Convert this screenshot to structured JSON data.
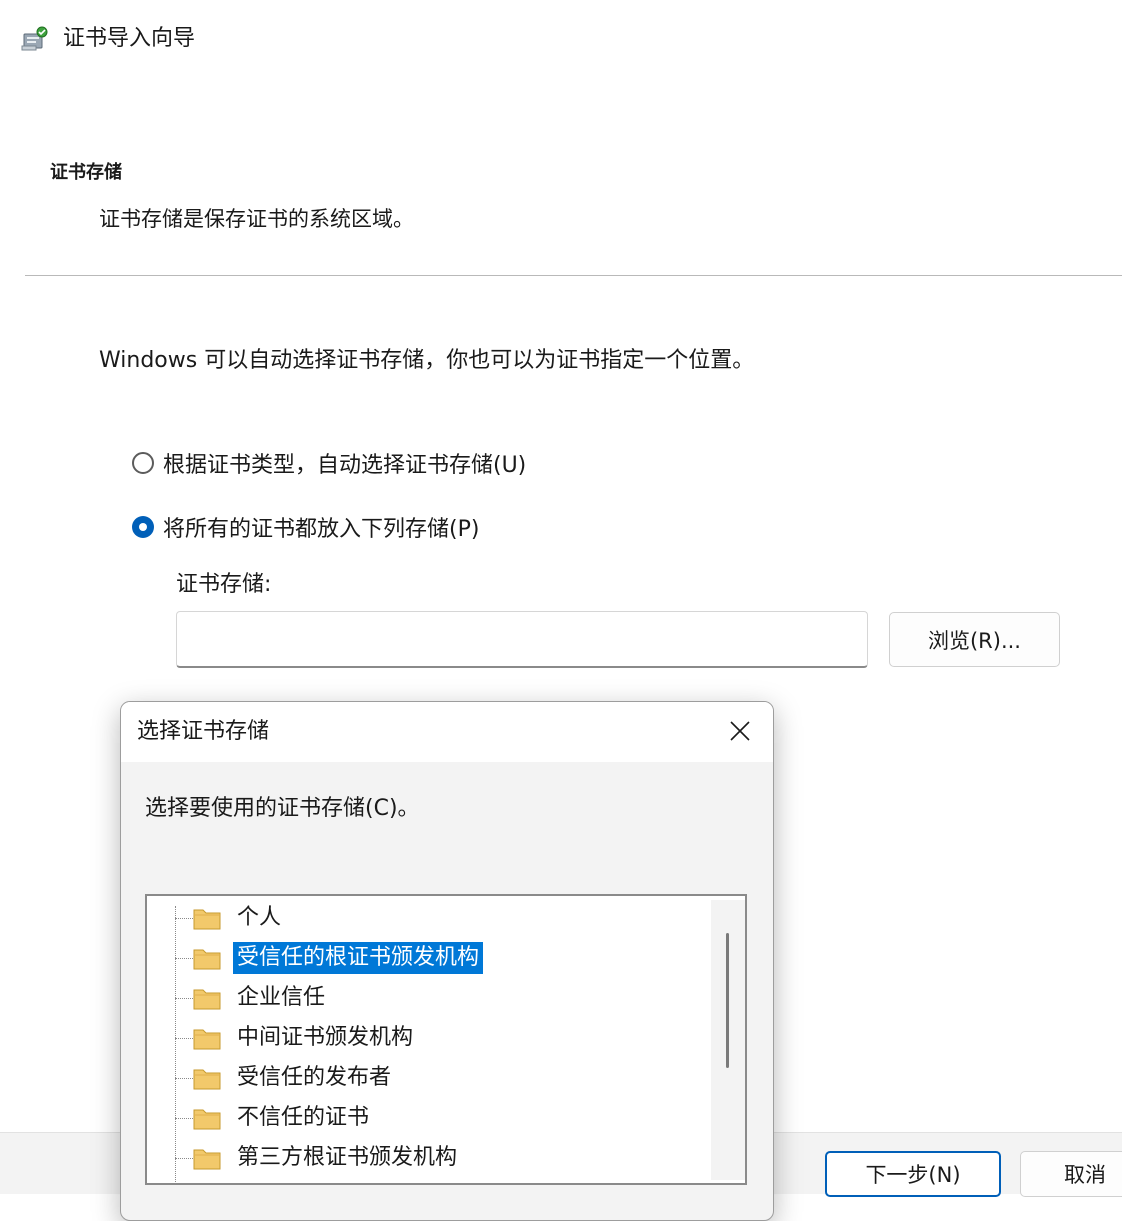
{
  "window": {
    "title": "证书导入向导"
  },
  "page": {
    "section_title": "证书存储",
    "section_desc": "证书存储是保存证书的系统区域。",
    "intro": "Windows 可以自动选择证书存储，你也可以为证书指定一个位置。"
  },
  "options": {
    "auto": {
      "label": "根据证书类型，自动选择证书存储(U)",
      "checked": false
    },
    "manual": {
      "label": "将所有的证书都放入下列存储(P)",
      "checked": true
    }
  },
  "store": {
    "label": "证书存储:",
    "value": ""
  },
  "buttons": {
    "browse": "浏览(R)...",
    "next": "下一步(N)",
    "cancel": "取消"
  },
  "dialog": {
    "title": "选择证书存储",
    "prompt": "选择要使用的证书存储(C)。",
    "stores": [
      {
        "label": "个人",
        "selected": false
      },
      {
        "label": "受信任的根证书颁发机构",
        "selected": true
      },
      {
        "label": "企业信任",
        "selected": false
      },
      {
        "label": "中间证书颁发机构",
        "selected": false
      },
      {
        "label": "受信任的发布者",
        "selected": false
      },
      {
        "label": "不信任的证书",
        "selected": false
      },
      {
        "label": "第三方根证书颁发机构",
        "selected": false
      }
    ]
  },
  "colors": {
    "accent": "#005fb8",
    "selection": "#0078d7",
    "folder": "#f2c96b"
  }
}
